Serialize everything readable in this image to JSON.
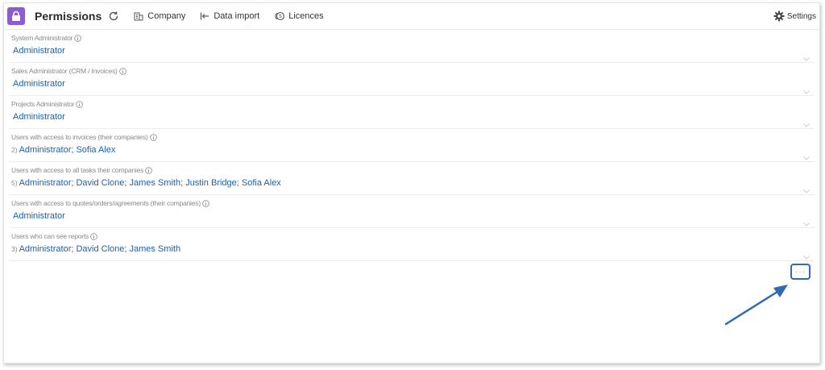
{
  "header": {
    "title": "Permissions",
    "company_label": "Company",
    "data_import_label": "Data import",
    "licences_label": "Licences",
    "settings_label": "Settings"
  },
  "colors": {
    "app_icon": "#8e5bd6",
    "value_text": "#1f5fa8",
    "highlight": "#2f6ab3"
  },
  "permissions": [
    {
      "label": "System Administrator",
      "count": "",
      "value": "Administrator"
    },
    {
      "label": "Sales Administrator (CRM / Invoices)",
      "count": "",
      "value": "Administrator"
    },
    {
      "label": "Projects Administrator",
      "count": "",
      "value": "Administrator"
    },
    {
      "label": "Users with access to invoices (their companies)",
      "count": "2)",
      "value": "Administrator; Sofia Alex"
    },
    {
      "label": "Users with access to all tasks their companies",
      "count": "5)",
      "value": "Administrator; David Clone; James Smith; Justin Bridge; Sofia Alex"
    },
    {
      "label": "Users with access to quotes/orders/agreements (their companies)",
      "count": "",
      "value": "Administrator"
    },
    {
      "label": "Users who can see reports",
      "count": "3)",
      "value": "Administrator; David Clone; James Smith"
    }
  ],
  "more_button_label": "···"
}
